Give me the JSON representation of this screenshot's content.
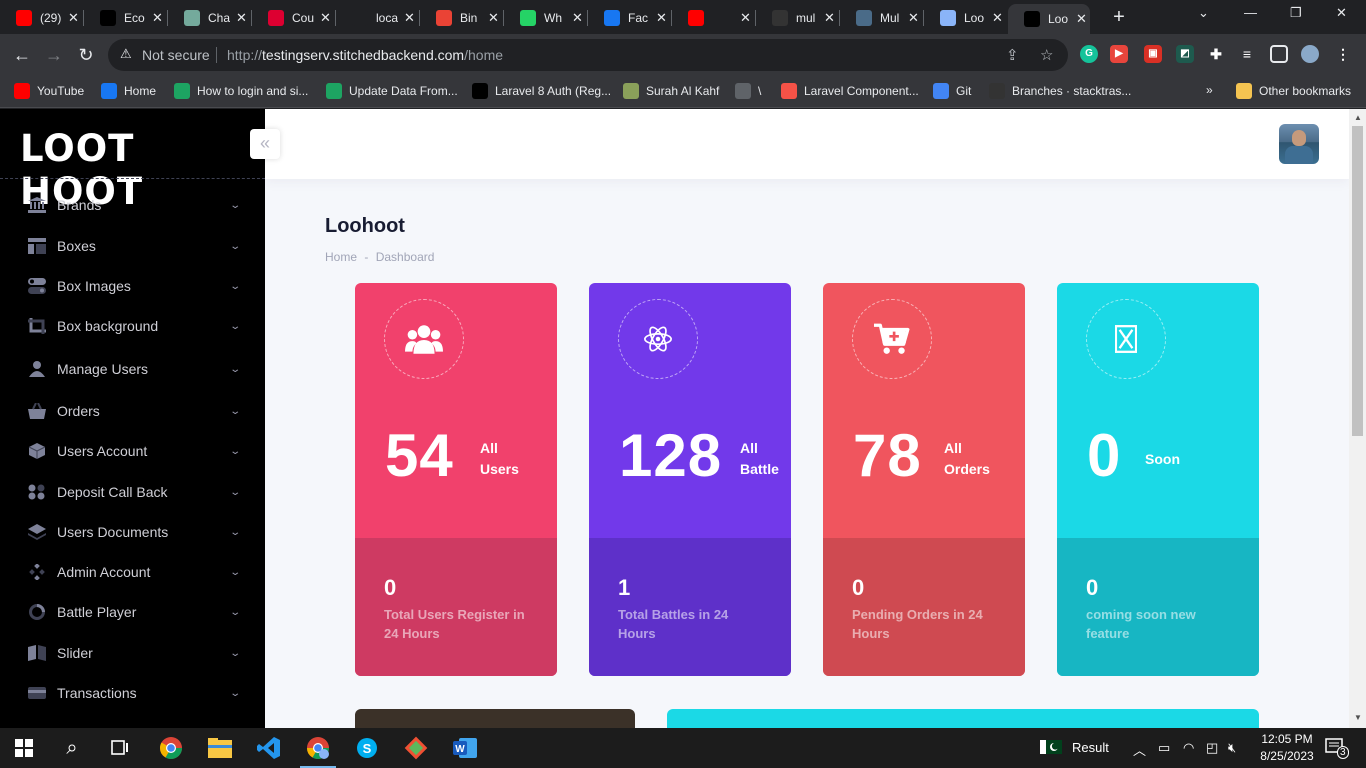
{
  "browser": {
    "tabs": [
      {
        "label": "(29)",
        "favicon": "youtube-icon",
        "color": "#ff0000"
      },
      {
        "label": "Eco",
        "favicon": "a-logo-icon",
        "color": "#000000"
      },
      {
        "label": "Cha",
        "favicon": "chatgpt-icon",
        "color": "#74aa9c"
      },
      {
        "label": "Cou",
        "favicon": "angular-icon",
        "color": "#dd0031"
      },
      {
        "label": "loca",
        "favicon": "blank-page-icon",
        "color": "#202124"
      },
      {
        "label": "Bin",
        "favicon": "gmail-icon",
        "color": "#ea4335"
      },
      {
        "label": "Wh",
        "favicon": "whatsapp-icon",
        "color": "#25d366"
      },
      {
        "label": "Fac",
        "favicon": "facebook-icon",
        "color": "#1877f2"
      },
      {
        "label": "",
        "favicon": "youtube-icon",
        "color": "#ff0000"
      },
      {
        "label": "mul",
        "favicon": "github-icon",
        "color": "#333333"
      },
      {
        "label": "Mul",
        "favicon": "photo-icon",
        "color": "#4a6b88"
      },
      {
        "label": "Loo",
        "favicon": "loading-icon",
        "color": "#8ab4f8"
      },
      {
        "label": "Loo",
        "favicon": "loothoot-icon",
        "color": "#000000"
      }
    ],
    "address": {
      "security": "Not secure",
      "url_prefix": "http://",
      "url_domain": "testingserv.stitchedbackend.com",
      "url_path": "/home"
    },
    "bookmarks": [
      {
        "label": "YouTube",
        "icon": "youtube-icon",
        "color": "#ff0000"
      },
      {
        "label": "Home",
        "icon": "facebook-icon",
        "color": "#1877f2"
      },
      {
        "label": "How to login and si...",
        "icon": "s-icon",
        "color": "#1da462"
      },
      {
        "label": "Update Data From...",
        "icon": "s-icon",
        "color": "#1da462"
      },
      {
        "label": "Laravel 8 Auth (Reg...",
        "icon": "dev-icon",
        "color": "#000000"
      },
      {
        "label": "Surah Al Kahf",
        "icon": "quran-icon",
        "color": "#8aa05a"
      },
      {
        "label": "\\",
        "icon": "globe-icon",
        "color": "#5f6368"
      },
      {
        "label": "Laravel Component...",
        "icon": "laravel-icon",
        "color": "#f55247"
      },
      {
        "label": "Git",
        "icon": "triangle-icon",
        "color": "#4285f4"
      },
      {
        "label": "Branches · stacktras...",
        "icon": "github-icon",
        "color": "#333333"
      }
    ],
    "other_bookmarks": "Other bookmarks"
  },
  "app": {
    "logo": "LOOT HOOT",
    "collapse_glyph": "«",
    "menu": [
      {
        "label": "Brands",
        "icon": "bank-icon"
      },
      {
        "label": "Boxes",
        "icon": "layout-icon"
      },
      {
        "label": "Box Images",
        "icon": "toggle-icon"
      },
      {
        "label": "Box background",
        "icon": "crop-icon"
      },
      {
        "label": "Manage Users",
        "icon": "user-icon"
      },
      {
        "label": "Orders",
        "icon": "basket-icon"
      },
      {
        "label": "Users Account",
        "icon": "cube-icon"
      },
      {
        "label": "Deposit Call Back",
        "icon": "dots-grid-icon"
      },
      {
        "label": "Users Documents",
        "icon": "layers-icon"
      },
      {
        "label": "Admin Account",
        "icon": "diamond-dots-icon"
      },
      {
        "label": "Battle Player",
        "icon": "spinner-icon"
      },
      {
        "label": "Slider",
        "icon": "book-icon"
      },
      {
        "label": "Transactions",
        "icon": "card-icon"
      }
    ],
    "page_title": "Loohoot",
    "breadcrumb": [
      "Home",
      "-",
      "Dashboard"
    ],
    "cards": [
      {
        "value": "54",
        "label_line1": "All",
        "label_line2": "Users",
        "sub_value": "0",
        "sub_label": "Total Users Register in 24 Hours",
        "icon": "users-icon",
        "color": "#f1416c",
        "bottom_color": "#ce3a62"
      },
      {
        "value": "128",
        "label_line1": "All",
        "label_line2": "Battle",
        "sub_value": "1",
        "sub_label": "Total Battles in 24 Hours",
        "icon": "electron-icon",
        "color": "#7239ea",
        "bottom_color": "#5e30c9"
      },
      {
        "value": "78",
        "label_line1": "All",
        "label_line2": "Orders",
        "sub_value": "0",
        "sub_label": "Pending Orders in 24 Hours",
        "icon": "cart-plus-icon",
        "color": "#f0555e",
        "bottom_color": "#cf4a51"
      },
      {
        "value": "0",
        "label_line1": "Soon",
        "label_line2": "",
        "sub_value": "0",
        "sub_label": "coming soon new feature",
        "icon": "hourglass-icon",
        "color": "#1bd9e6",
        "bottom_color": "#17b6c3"
      }
    ]
  },
  "taskbar": {
    "weather": "Result",
    "time": "12:05 PM",
    "date": "8/25/2023",
    "notifications": "3"
  }
}
